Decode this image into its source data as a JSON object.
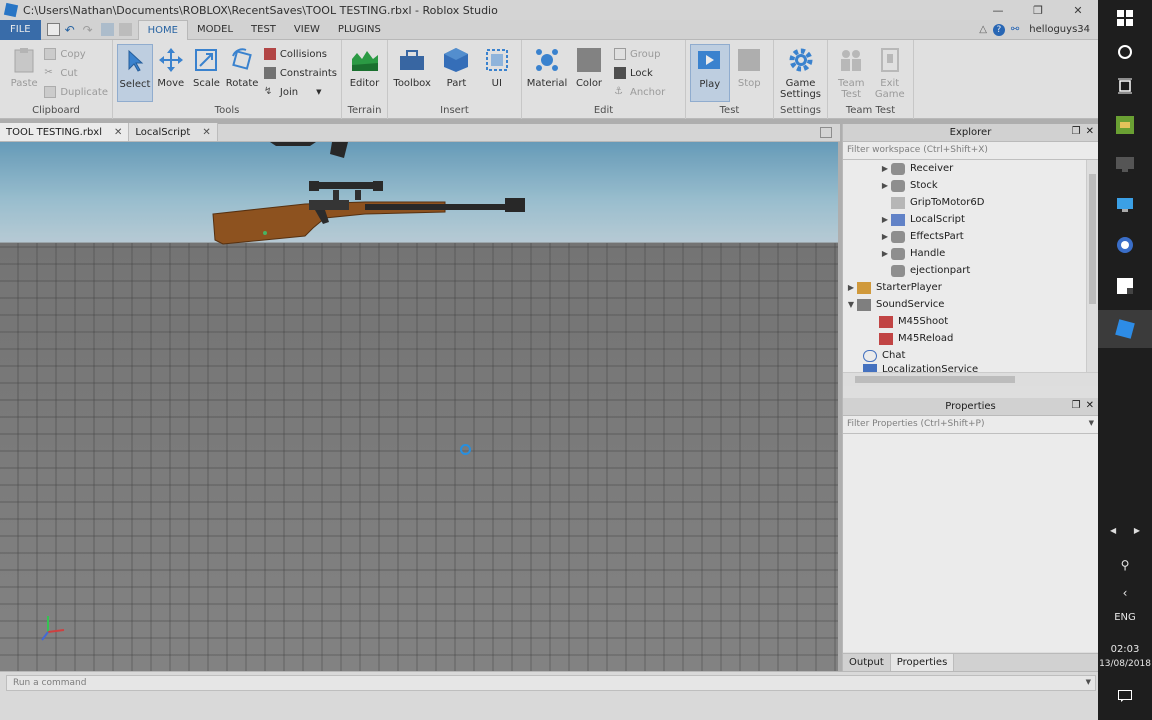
{
  "window": {
    "title": "C:\\Users\\Nathan\\Documents\\ROBLOX\\RecentSaves\\TOOL TESTING.rbxl - Roblox Studio",
    "minimize": "—",
    "maximize": "❐",
    "close": "✕"
  },
  "menu": {
    "file": "FILE",
    "tabs": [
      "HOME",
      "MODEL",
      "TEST",
      "VIEW",
      "PLUGINS"
    ],
    "active_tab": "HOME",
    "user": "helloguys34",
    "help": "?"
  },
  "ribbon": {
    "clipboard": {
      "label": "Clipboard",
      "paste": "Paste",
      "copy": "Copy",
      "cut": "Cut",
      "duplicate": "Duplicate"
    },
    "tools": {
      "label": "Tools",
      "select": "Select",
      "move": "Move",
      "scale": "Scale",
      "rotate": "Rotate",
      "collisions": "Collisions",
      "constraints": "Constraints",
      "join": "Join"
    },
    "terrain": {
      "label": "Terrain",
      "editor": "Editor"
    },
    "insert": {
      "label": "Insert",
      "toolbox": "Toolbox",
      "part": "Part",
      "ui": "UI"
    },
    "edit": {
      "label": "Edit",
      "material": "Material",
      "color": "Color",
      "group": "Group",
      "lock": "Lock",
      "anchor": "Anchor"
    },
    "test": {
      "label": "Test",
      "play": "Play",
      "stop": "Stop"
    },
    "settings": {
      "label": "Settings",
      "game_settings_1": "Game",
      "game_settings_2": "Settings"
    },
    "team_test": {
      "label": "Team Test",
      "team_test_1": "Team",
      "team_test_2": "Test",
      "exit_game_1": "Exit",
      "exit_game_2": "Game"
    }
  },
  "doc_tabs": [
    {
      "label": "TOOL TESTING.rbxl"
    },
    {
      "label": "LocalScript"
    }
  ],
  "explorer": {
    "title": "Explorer",
    "filter_placeholder": "Filter workspace (Ctrl+Shift+X)",
    "items": [
      {
        "label": "Receiver"
      },
      {
        "label": "Stock"
      },
      {
        "label": "GripToMotor6D"
      },
      {
        "label": "LocalScript"
      },
      {
        "label": "EffectsPart"
      },
      {
        "label": "Handle"
      },
      {
        "label": "ejectionpart"
      },
      {
        "label": "StarterPlayer"
      },
      {
        "label": "SoundService"
      },
      {
        "label": "M45Shoot"
      },
      {
        "label": "M45Reload"
      },
      {
        "label": "Chat"
      },
      {
        "label": "LocalizationService"
      }
    ]
  },
  "properties": {
    "title": "Properties",
    "filter_placeholder": "Filter Properties (Ctrl+Shift+P)"
  },
  "bottom_tabs": [
    "Output",
    "Properties"
  ],
  "command_bar": {
    "placeholder": "Run a command"
  },
  "taskbar": {
    "lang": "ENG",
    "time": "02:03",
    "date": "13/08/2018"
  },
  "colors": {
    "accent": "#2b6cb0",
    "file_menu": "#3e76b8",
    "selected_tool": "#cfe0f3"
  }
}
